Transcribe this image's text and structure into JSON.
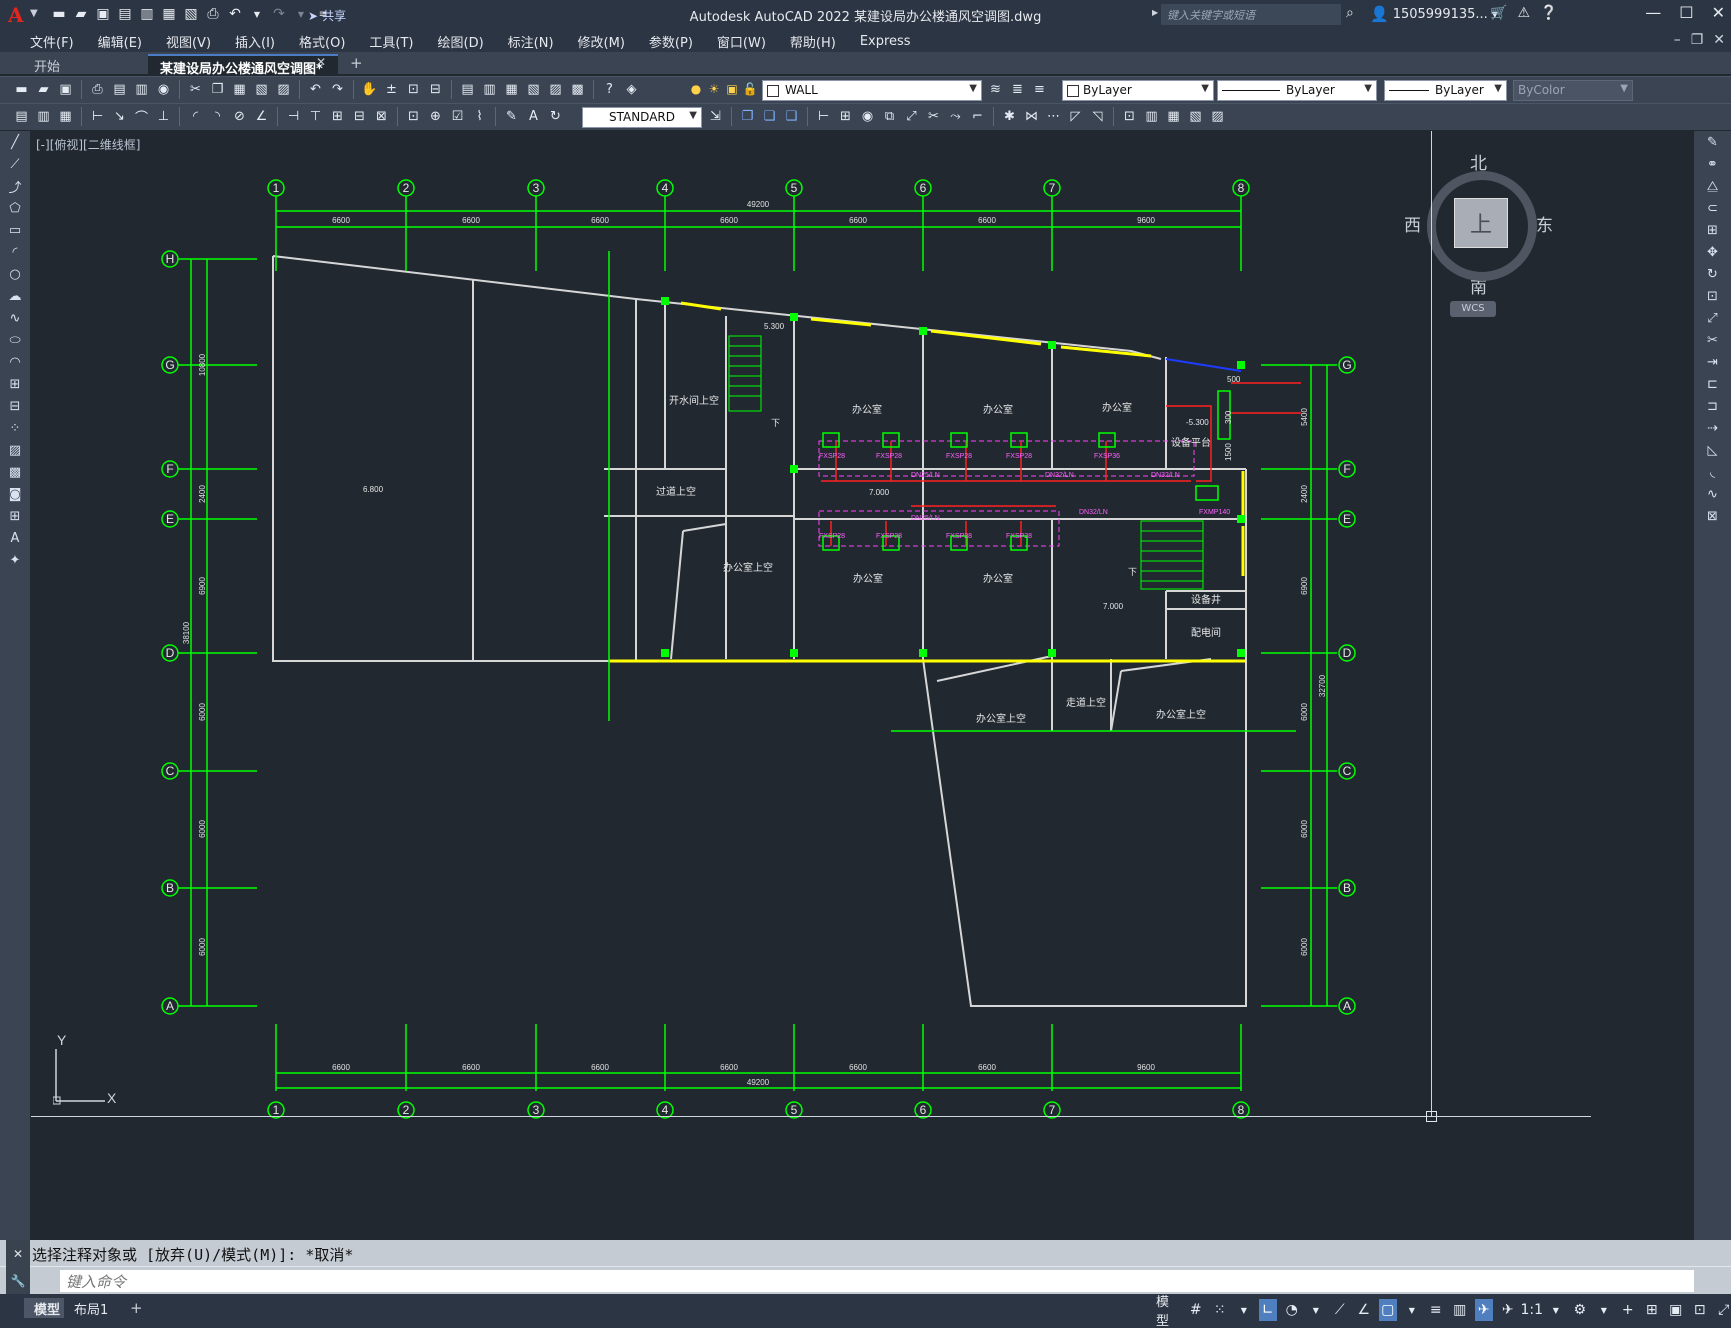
{
  "app": {
    "logo": "A",
    "window_title": "Autodesk AutoCAD 2022    某建设局办公楼通风空调图.dwg",
    "share_label": "共享",
    "search_placeholder": "键入关键字或短语",
    "user_name": "1505999135...",
    "accent_color": "#e5261f"
  },
  "menu": [
    "文件(F)",
    "编辑(E)",
    "视图(V)",
    "插入(I)",
    "格式(O)",
    "工具(T)",
    "绘图(D)",
    "标注(N)",
    "修改(M)",
    "参数(P)",
    "窗口(W)",
    "帮助(H)",
    "Express"
  ],
  "tabs": {
    "start": "开始",
    "drawing": "某建设局办公楼通风空调图*"
  },
  "toolbar": {
    "layer": "WALL",
    "color": "ByLayer",
    "linetype": "ByLayer",
    "lineweight": "ByLayer",
    "plotstyle": "ByColor",
    "textstyle": "STANDARD"
  },
  "viewport": {
    "label": "[-][俯视][二维线框]",
    "compass": {
      "north": "北",
      "south": "南",
      "west": "西",
      "east": "东",
      "face": "上"
    },
    "wcs": "WCS",
    "ucs": {
      "x": "X",
      "y": "Y"
    }
  },
  "drawing": {
    "grid_numbers": [
      "1",
      "2",
      "3",
      "4",
      "5",
      "6",
      "7",
      "8"
    ],
    "grid_letters": [
      "H",
      "G",
      "F",
      "E",
      "D",
      "C",
      "B",
      "A"
    ],
    "top_dims": [
      "6600",
      "6600",
      "6600",
      "6600",
      "6600",
      "6600",
      "9600"
    ],
    "top_total": "49200",
    "bottom_dims": [
      "6600",
      "6600",
      "6600",
      "6600",
      "6600",
      "6600",
      "9600"
    ],
    "bottom_total": "49200",
    "left_dims": [
      "10800",
      "2400",
      "6900",
      "6000",
      "6000",
      "6000"
    ],
    "left_total": "38100",
    "right_dims": [
      "5400",
      "2400",
      "6900",
      "6000",
      "6000",
      "6000"
    ],
    "right_total": "32700",
    "rooms": {
      "r1": "开水间上空",
      "r2": "办公室",
      "r3": "办公室",
      "r4": "办公室",
      "r5": "设备平台",
      "r6": "过道上空",
      "r7": "办公室上空",
      "r8": "办公室",
      "r9": "办公室",
      "r10": "设备井",
      "r11": "配电间",
      "r12": "办公室上空",
      "r13": "走道上空",
      "r14": "办公室上空"
    },
    "elevations": {
      "e1": "6.800",
      "e2": "5.300",
      "e3": "7.000",
      "e4": "7.000",
      "e5": "-5.300"
    },
    "units": {
      "u1": "FXSP28",
      "u2": "FXSP28",
      "u3": "FXSP28",
      "u4": "FXSP28",
      "u5": "FXSP36",
      "u6": "FXSP28",
      "u7": "FXSP28",
      "u8": "FXSP28",
      "u9": "FXSP28",
      "u10": "FXMP140"
    },
    "dim_small": {
      "d500": "500",
      "d300": "300",
      "d1500": "1500"
    },
    "stair_marks": {
      "s1": "下",
      "s2": "下"
    },
    "pipe_tags": {
      "p1": "DN25/LN",
      "p2": "DN32/LN",
      "p3": "DN32/LN",
      "p4": "DN25/LN",
      "p5": "DN32/LN"
    },
    "colors": {
      "axis": "#00ff00",
      "wall": "#d8d8d8",
      "window": "#ffff00",
      "pipe": "#ff2020",
      "duct": "#ff40ff",
      "unit": "#00ff00",
      "blue": "#1e3cff"
    }
  },
  "command": {
    "history": "选择注释对象或 [放弃(U)/模式(M)]: *取消*",
    "placeholder": "键入命令"
  },
  "status": {
    "model_tab": "模型",
    "layout_tab": "布局1",
    "model_label": "模型",
    "scale": "1:1"
  }
}
